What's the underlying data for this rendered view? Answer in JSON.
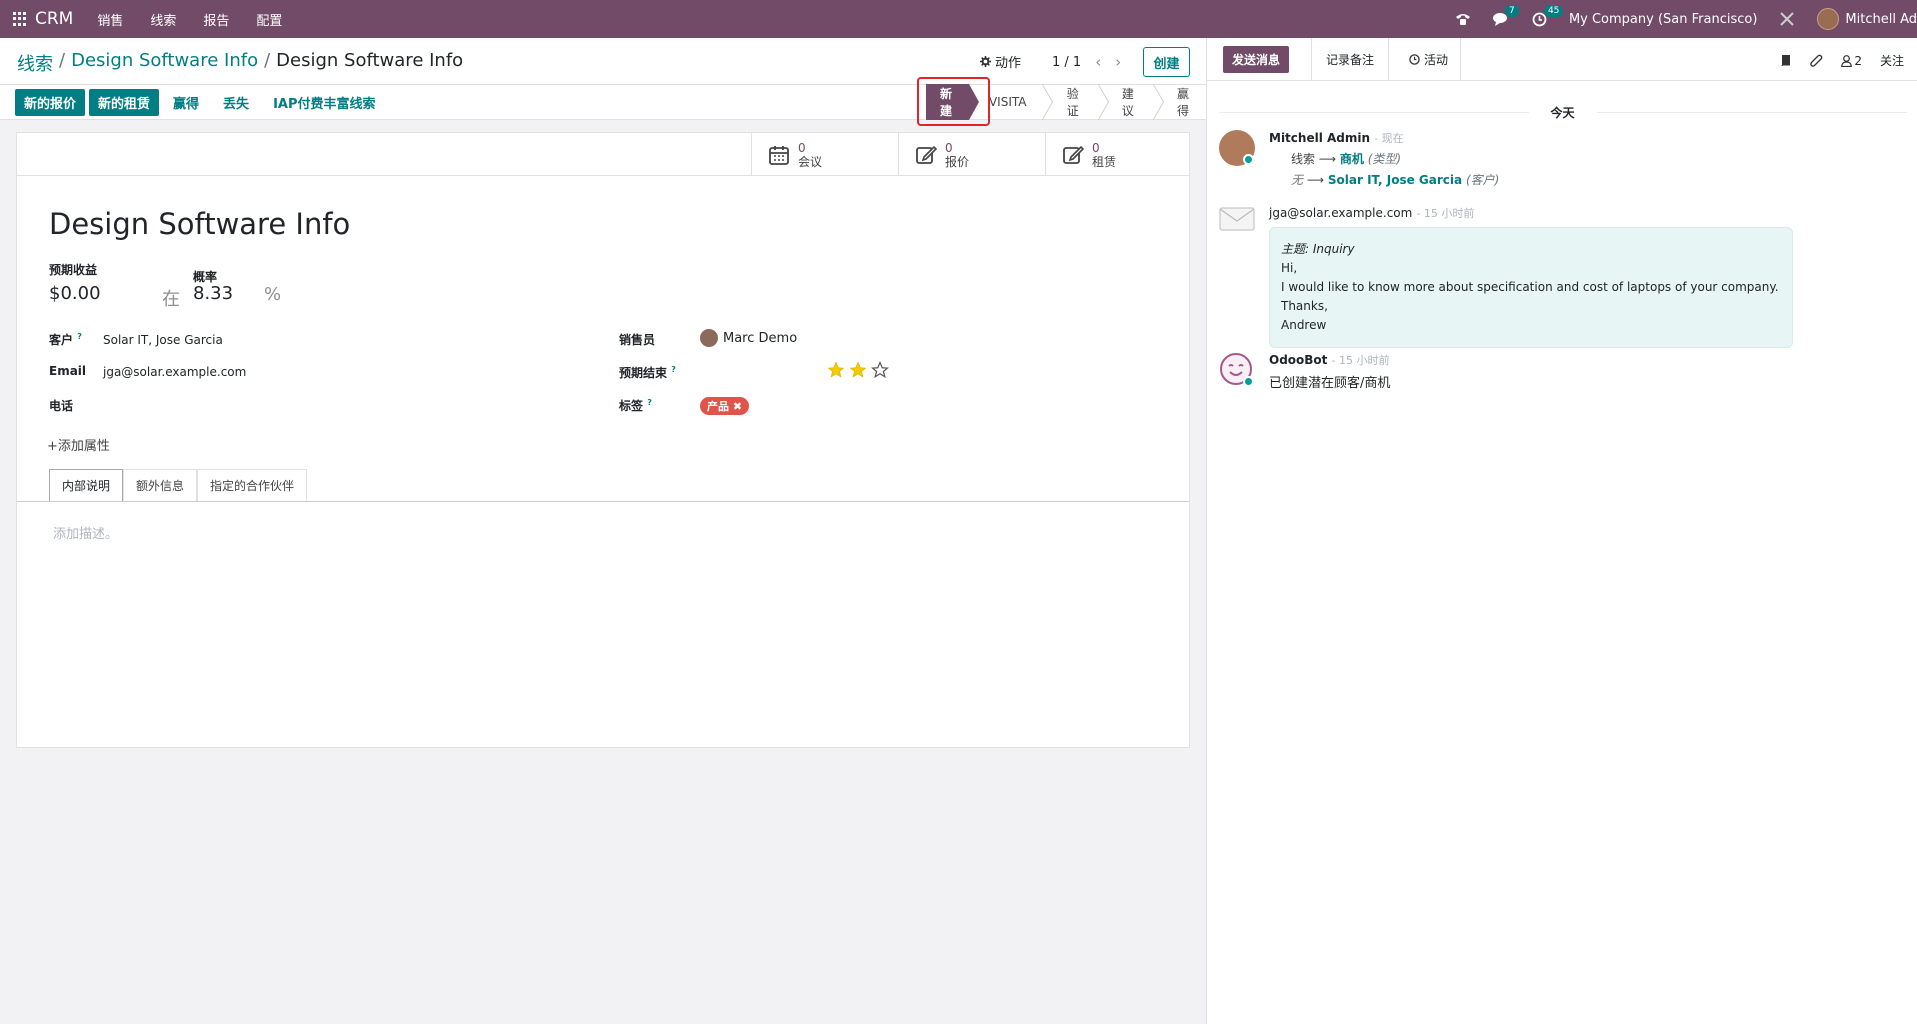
{
  "navbar": {
    "brand": "CRM",
    "menu": [
      "销售",
      "线索",
      "报告",
      "配置"
    ],
    "chat_badge": "7",
    "activity_badge": "45",
    "company": "My Company (San Francisco)",
    "user": "Mitchell Ad"
  },
  "breadcrumb": {
    "root": "线索",
    "parent": "Design Software Info",
    "current": "Design Software Info",
    "sep": "/"
  },
  "control": {
    "action_label": "动作",
    "pager": "1 / 1",
    "create_label": "创建"
  },
  "header_buttons": {
    "new_quotation": "新的报价",
    "new_rental": "新的租赁",
    "won": "赢得",
    "lost": "丢失",
    "iap_enrich": "IAP付费丰富线索"
  },
  "stages": [
    "新建",
    "VISITA",
    "验证",
    "建议",
    "赢得"
  ],
  "smart_buttons": [
    {
      "value": "0",
      "label": "会议",
      "icon": "calendar-icon"
    },
    {
      "value": "0",
      "label": "报价",
      "icon": "edit-icon"
    },
    {
      "value": "0",
      "label": "租赁",
      "icon": "edit-icon"
    }
  ],
  "form": {
    "title": "Design Software Info",
    "expected_revenue_label": "预期收益",
    "expected_revenue": "$0.00",
    "at_label": "在",
    "probability_label": "概率",
    "probability": "8.33",
    "percent": "%",
    "customer_label": "客户",
    "customer": "Solar IT, Jose Garcia",
    "email_label": "Email",
    "email": "jga@solar.example.com",
    "phone_label": "电话",
    "salesperson_label": "销售员",
    "salesperson": "Marc Demo",
    "expected_close_label": "预期结束",
    "tags_label": "标签",
    "tag": "产品",
    "priority_stars": 2,
    "priority_max": 3,
    "add_property": "添加属性",
    "help_mark": "?"
  },
  "tabs": [
    "内部说明",
    "额外信息",
    "指定的合作伙伴"
  ],
  "description_placeholder": "添加描述。",
  "chatter": {
    "send_message": "发送消息",
    "log_note": "记录备注",
    "activity": "活动",
    "followers": "2",
    "follow": "关注",
    "today": "今天",
    "messages": [
      {
        "author": "Mitchell Admin",
        "time": "- 现在",
        "line1_from": "线索",
        "line1_to": "商机",
        "line1_field": "(类型)",
        "line2_from": "无",
        "line2_to": "Solar IT, Jose Garcia",
        "line2_field": "(客户)"
      },
      {
        "author": "jga@solar.example.com",
        "time": "- 15 小时前",
        "subject": "主题: Inquiry",
        "body": [
          "Hi,",
          "I would like to know more about specification and cost of laptops of your company.",
          "Thanks,",
          "Andrew"
        ]
      },
      {
        "author": "OdooBot",
        "time": "- 15 小时前",
        "text": "已创建潜在顾客/商机"
      }
    ]
  },
  "colors": {
    "brand": "#714b67",
    "accent": "#017e84",
    "tag": "#e0544a",
    "star": "#f3cc00"
  }
}
